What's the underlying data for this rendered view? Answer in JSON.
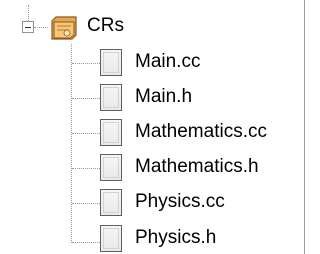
{
  "tree": {
    "root": {
      "label": "CRs",
      "icon": "folder-icon",
      "expanded": true
    },
    "items": [
      {
        "label": "Main.cc",
        "icon": "file-icon"
      },
      {
        "label": "Main.h",
        "icon": "file-icon"
      },
      {
        "label": "Mathematics.cc",
        "icon": "file-icon"
      },
      {
        "label": "Mathematics.h",
        "icon": "file-icon"
      },
      {
        "label": "Physics.cc",
        "icon": "file-icon"
      },
      {
        "label": "Physics.h",
        "icon": "file-icon"
      }
    ]
  },
  "colors": {
    "folder_fill": "#f5c77a",
    "folder_stroke": "#8a5a1f",
    "tree_line": "#9a9a9a"
  }
}
